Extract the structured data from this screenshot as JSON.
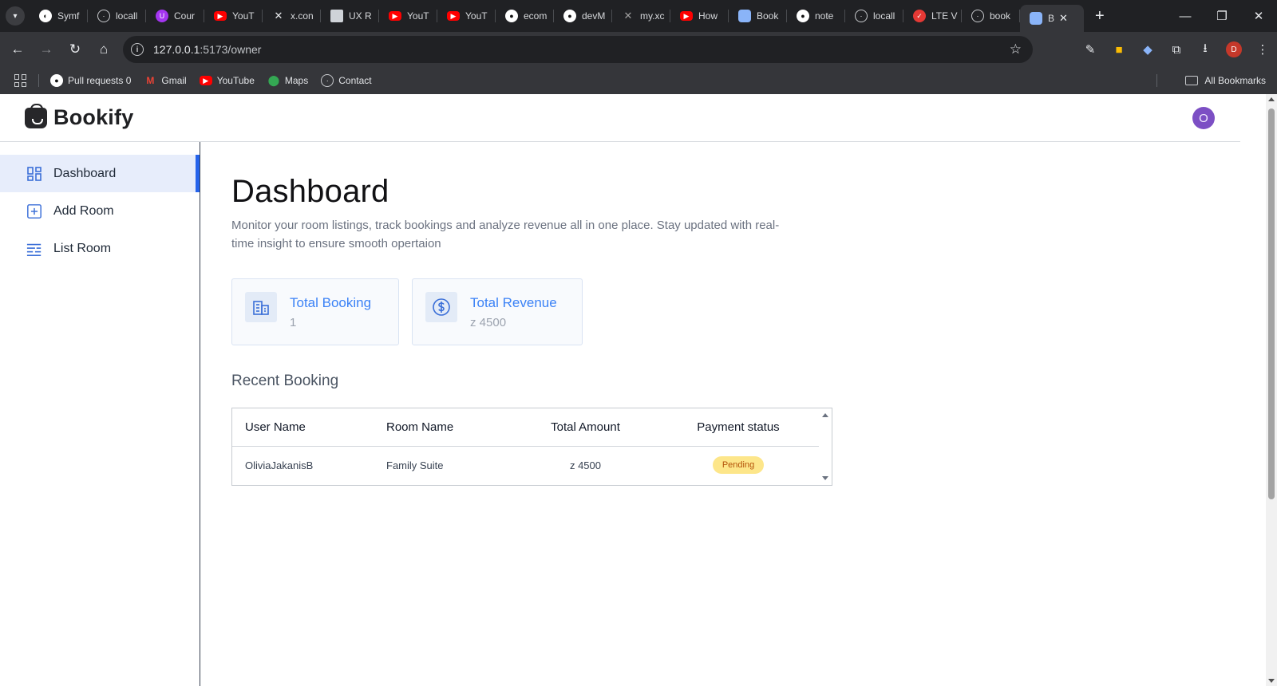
{
  "browser": {
    "tabs": [
      {
        "label": "Symf",
        "icon": "symfony-icon",
        "color": "#1f1f1f"
      },
      {
        "label": "locall",
        "icon": "globe-icon",
        "color": "#5f6368"
      },
      {
        "label": "Cour",
        "icon": "udemy-icon",
        "color": "#a435f0"
      },
      {
        "label": "YouT",
        "icon": "youtube-icon",
        "color": "#ff0000"
      },
      {
        "label": "x.con",
        "icon": "x-icon",
        "color": "#000000"
      },
      {
        "label": "UX R",
        "icon": "doc-icon",
        "color": "#cfd3d8"
      },
      {
        "label": "YouT",
        "icon": "youtube-icon",
        "color": "#ff0000"
      },
      {
        "label": "YouT",
        "icon": "youtube-icon",
        "color": "#ff0000"
      },
      {
        "label": "ecom",
        "icon": "github-icon",
        "color": "#1f1f1f"
      },
      {
        "label": "devM",
        "icon": "github-icon",
        "color": "#1f1f1f"
      },
      {
        "label": "my.xc",
        "icon": "x-icon",
        "color": "#4b4b4b"
      },
      {
        "label": "How",
        "icon": "youtube-icon",
        "color": "#ff0000"
      },
      {
        "label": "Book",
        "icon": "bookify-icon",
        "color": "#8ab4f8"
      },
      {
        "label": "note",
        "icon": "github-icon",
        "color": "#1f1f1f"
      },
      {
        "label": "locall",
        "icon": "globe-icon",
        "color": "#5f6368"
      },
      {
        "label": "LTE V",
        "icon": "lte-icon",
        "color": "#e53935"
      },
      {
        "label": "book",
        "icon": "globe-icon",
        "color": "#5f6368"
      }
    ],
    "active_tab": {
      "label": "B",
      "icon": "bookify-icon",
      "color": "#8ab4f8"
    },
    "url_host": "127.0.0.1",
    "url_path": ":5173/owner",
    "bookmarks": [
      {
        "label": "Pull requests 0",
        "icon": "github-icon",
        "color": "#1f1f1f"
      },
      {
        "label": "Gmail",
        "icon": "gmail-icon",
        "color": "#ea4335"
      },
      {
        "label": "YouTube",
        "icon": "youtube-icon",
        "color": "#ff0000"
      },
      {
        "label": "Maps",
        "icon": "maps-icon",
        "color": "#34a853"
      },
      {
        "label": "Contact",
        "icon": "globe-icon",
        "color": "#5f6368"
      }
    ],
    "all_bookmarks": "All Bookmarks",
    "profile_initial": "D"
  },
  "app": {
    "brand": "Bookify",
    "avatar_initial": "O",
    "accent": "#2563eb",
    "sidebar": {
      "items": [
        {
          "label": "Dashboard",
          "icon": "dashboard-grid-icon",
          "active": true
        },
        {
          "label": "Add Room",
          "icon": "plus-square-icon",
          "active": false
        },
        {
          "label": "List Room",
          "icon": "list-icon",
          "active": false
        }
      ]
    },
    "main": {
      "title": "Dashboard",
      "description": "Monitor your room listings, track bookings and analyze revenue all in one place. Stay updated with real-time insight to ensure smooth opertaion",
      "cards": [
        {
          "title": "Total Booking",
          "value": "1",
          "icon": "building-icon"
        },
        {
          "title": "Total Revenue",
          "value": "z 4500",
          "icon": "dollar-circle-icon"
        }
      ],
      "recent_title": "Recent Booking",
      "table": {
        "headers": [
          "User Name",
          "Room Name",
          "Total Amount",
          "Payment status"
        ],
        "rows": [
          {
            "user": "OliviaJakanisB",
            "room": "Family Suite",
            "amount": "z 4500",
            "status": "Pending"
          }
        ]
      }
    }
  }
}
